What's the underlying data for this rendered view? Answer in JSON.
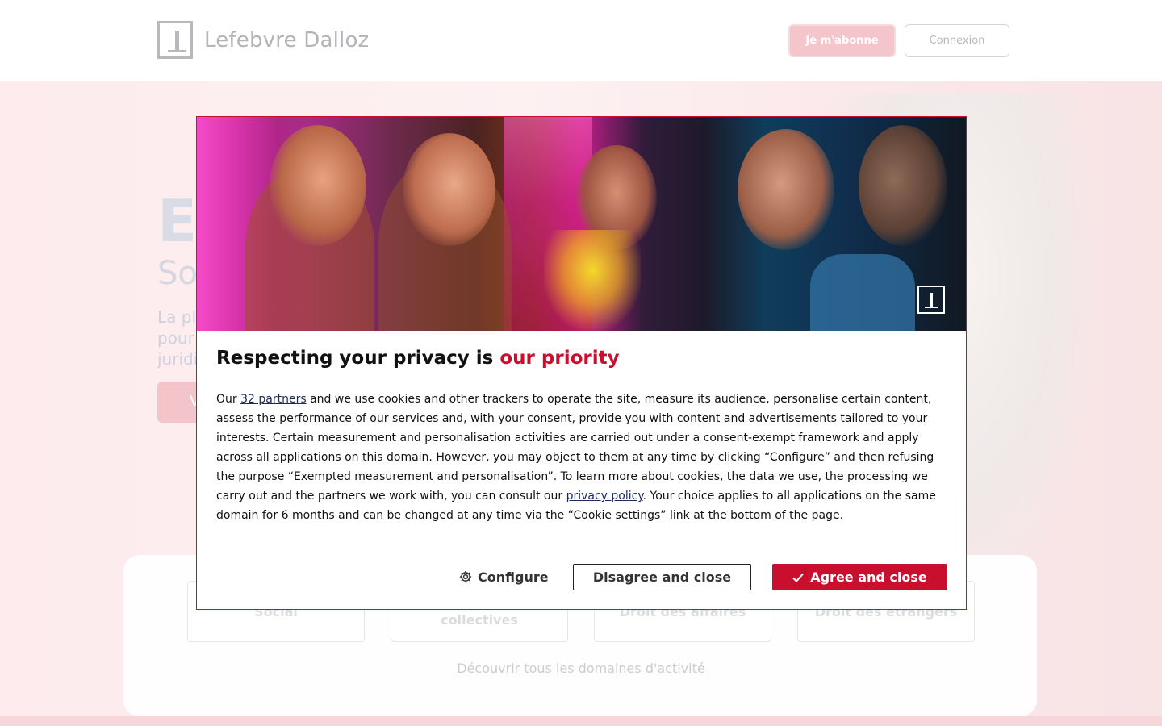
{
  "header": {
    "logo_text": "Lefebvre Dalloz",
    "subscribe_label": "Je m'abonne",
    "login_label": "Connexion"
  },
  "hero": {
    "title_fragment": "E",
    "subtitle_fragment": "So",
    "paragraph_fragment": "La pl pour juridi",
    "cta_fragment": "V"
  },
  "domains": {
    "cards": [
      "Social",
      "collectives",
      "Droit des affaires",
      "Droit des étrangers"
    ],
    "discover_link": "Découvrir tous les domaines d'activité"
  },
  "modal": {
    "title_main": "Respecting your privacy is ",
    "title_accent": "our priority",
    "body": {
      "part1": "Our ",
      "partners_link": "32 partners",
      "part2": " and we use cookies and other trackers to operate the site, measure its audience, personalise certain content, assess the performance of our services and, with your consent, provide you with content and advertisements tailored to your interests. Certain measurement and personalisation activities are carried out under a consent-exempt framework and apply across all applications on this domain. However, you may object to them at any time by clicking “Configure” and then refusing the purpose “Exempted measurement and personalisation”. To learn more about cookies, the data we use, the processing we carry out and the partners we work with, you can consult our ",
      "privacy_link": "privacy policy",
      "part3": ". Your choice applies to all applications on the same domain for 6 months and can be changed at any time via the “Cookie settings” link at the bottom of the page."
    },
    "configure_label": "Configure",
    "disagree_label": "Disagree and close",
    "agree_label": "Agree and close",
    "configure_icon": "gear-icon",
    "agree_icon": "check-icon",
    "accent_color": "#c8102e"
  }
}
